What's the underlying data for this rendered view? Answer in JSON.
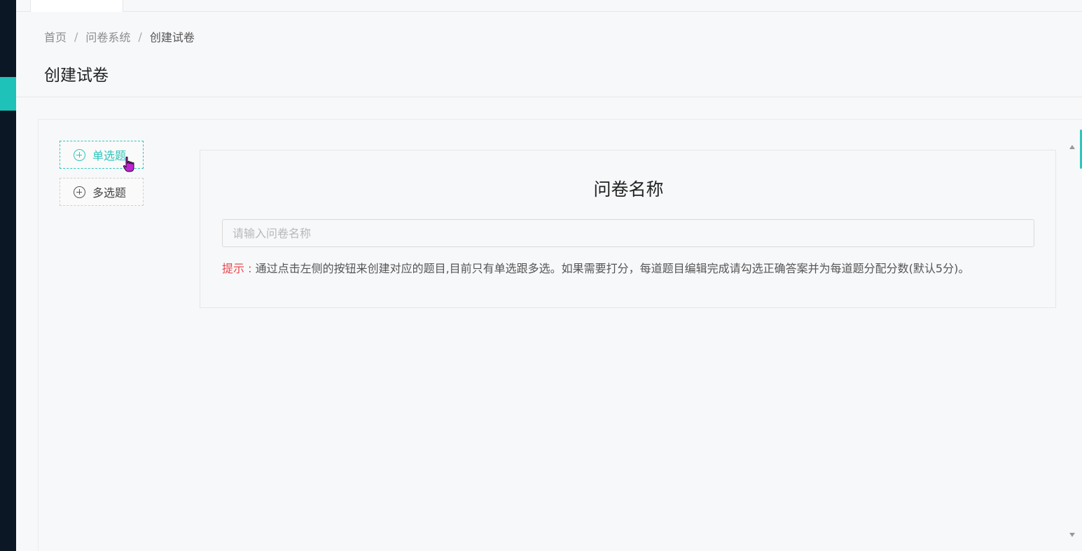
{
  "breadcrumb": {
    "items": [
      "首页",
      "问卷系统",
      "创建试卷"
    ],
    "separator": "/"
  },
  "page": {
    "title": "创建试卷"
  },
  "question_buttons": {
    "single_choice": "单选题",
    "multiple_choice": "多选题"
  },
  "survey": {
    "title": "问卷名称",
    "name_input": {
      "value": "",
      "placeholder": "请输入问卷名称"
    },
    "tip_label": "提示 : ",
    "tip_text": "通过点击左侧的按钮来创建对应的题目,目前只有单选跟多选。如果需要打分，每道题目编辑完成请勾选正确答案并为每道题分配分数(默认5分)。"
  },
  "colors": {
    "accent": "#2ec6bb",
    "sidebar": "#0b1724",
    "tip_label": "#e9474d"
  }
}
